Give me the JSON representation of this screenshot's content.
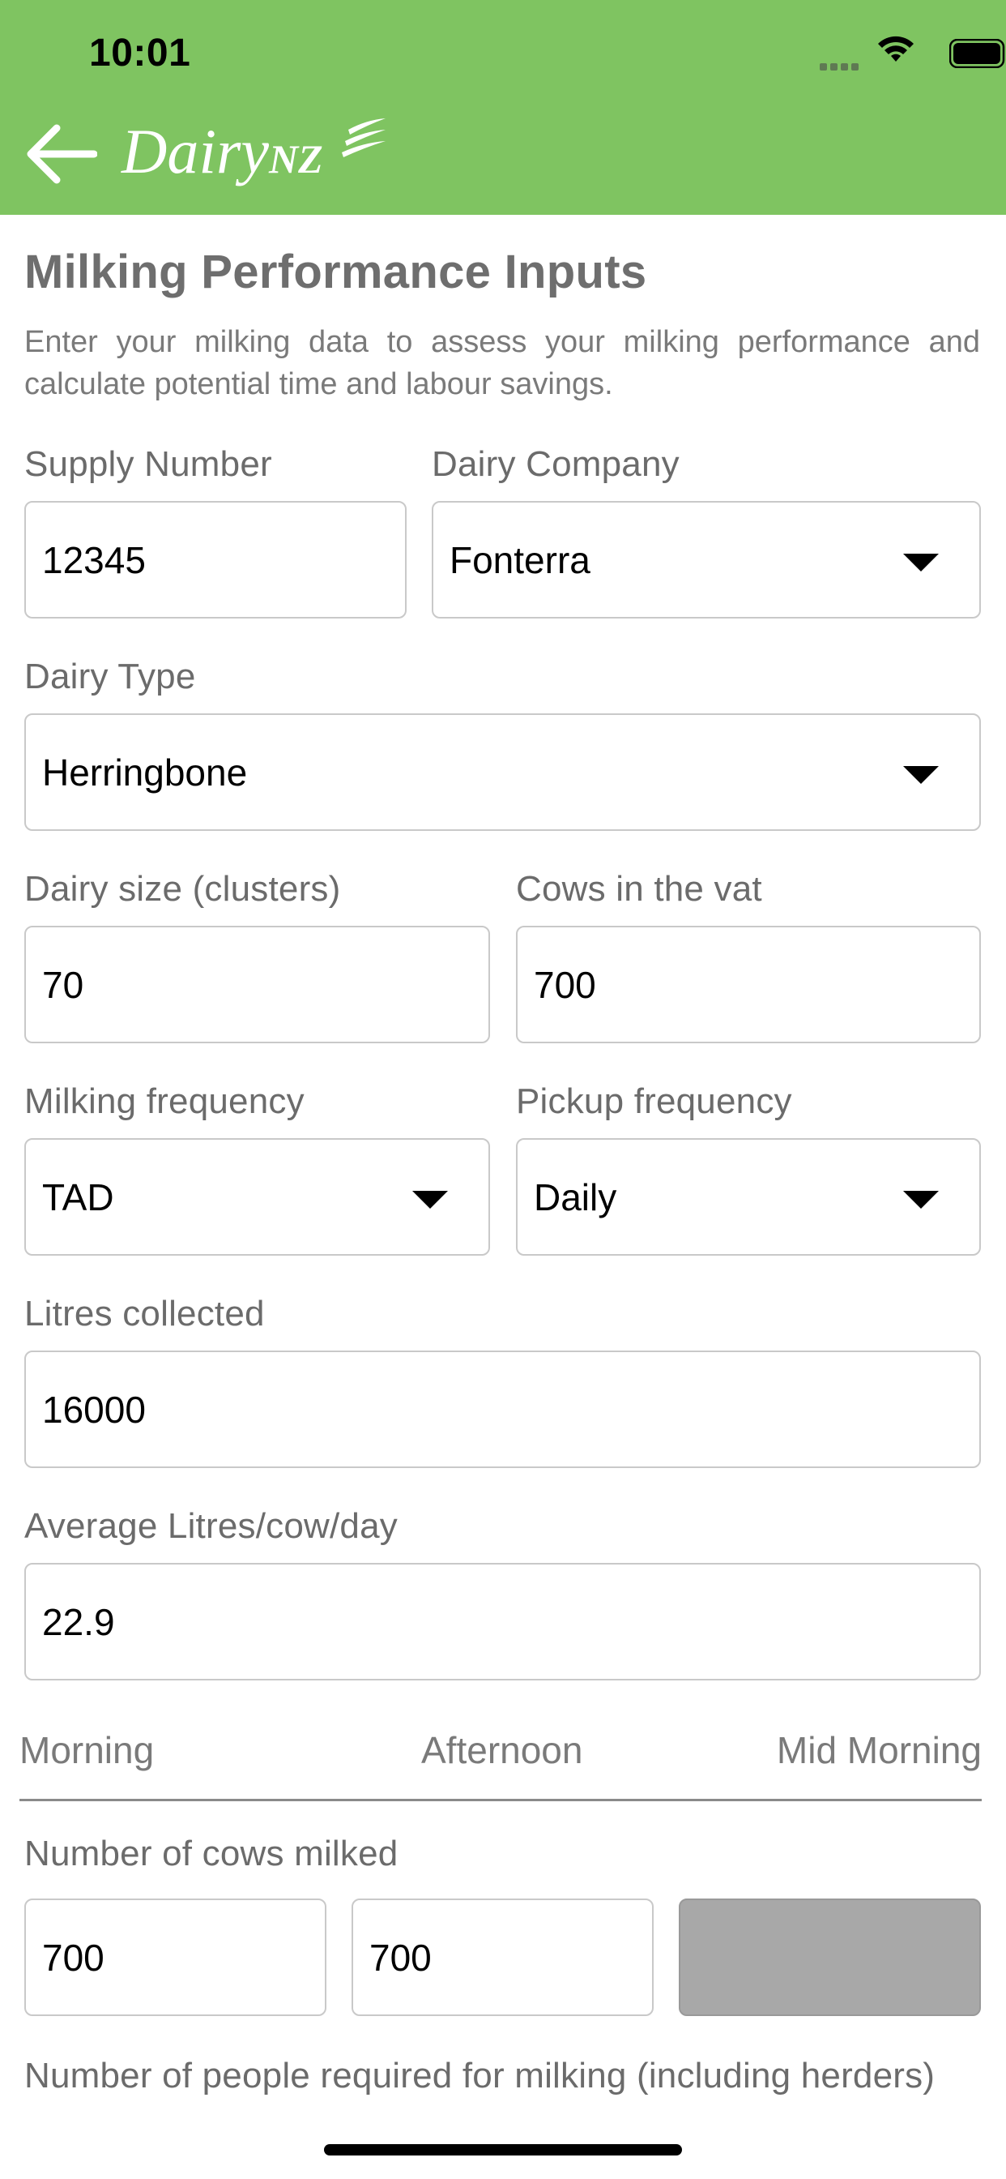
{
  "status_bar": {
    "time": "10:01"
  },
  "header": {
    "logo_main": "Dairy",
    "logo_suffix": "NZ",
    "back_icon": "arrow-left-icon"
  },
  "page": {
    "title": "Milking Performance Inputs",
    "description": "Enter your milking data to assess your milking performance and calculate potential time and labour savings."
  },
  "form": {
    "supply_number": {
      "label": "Supply Number",
      "value": "12345"
    },
    "dairy_company": {
      "label": "Dairy Company",
      "value": "Fonterra"
    },
    "dairy_type": {
      "label": "Dairy Type",
      "value": "Herringbone"
    },
    "dairy_size": {
      "label": "Dairy size (clusters)",
      "value": "70"
    },
    "cows_in_vat": {
      "label": "Cows in the vat",
      "value": "700"
    },
    "milking_frequency": {
      "label": "Milking frequency",
      "value": "TAD"
    },
    "pickup_frequency": {
      "label": "Pickup frequency",
      "value": "Daily"
    },
    "litres_collected": {
      "label": "Litres collected",
      "value": "16000"
    },
    "avg_litres": {
      "label": "Average Litres/cow/day",
      "value": "22.9"
    }
  },
  "session_columns": [
    "Morning",
    "Afternoon",
    "Mid Morning"
  ],
  "cows_milked": {
    "label": "Number of cows milked",
    "values": [
      "700",
      "700",
      ""
    ]
  },
  "people_required": {
    "label": "Number of people required for milking (including herders)"
  },
  "colors": {
    "header_green": "#7fc461",
    "label_grey": "#6b6b6b",
    "disabled_grey": "#a8a8a8"
  }
}
